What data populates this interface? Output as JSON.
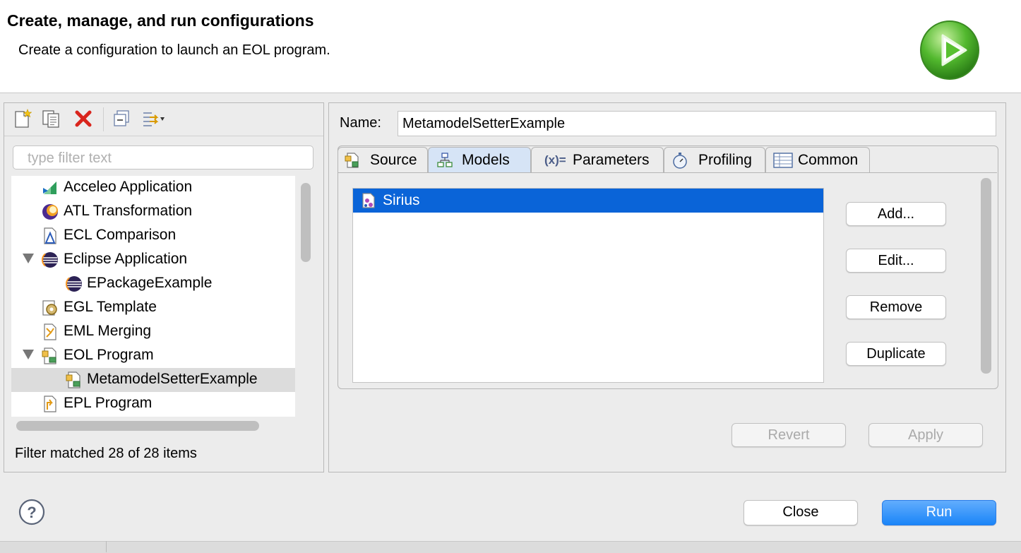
{
  "header": {
    "title": "Create, manage, and run configurations",
    "subtitle": "Create a configuration to launch an EOL program."
  },
  "left": {
    "toolbar": [
      "new-launch-configuration-icon",
      "duplicate-icon",
      "delete-icon",
      "collapse-all-icon",
      "filter-icon"
    ],
    "filter_placeholder": "type filter text",
    "tree": [
      {
        "label": "Acceleo Application",
        "icon": "acceleo-icon",
        "level": 0,
        "expanded": false
      },
      {
        "label": "ATL Transformation",
        "icon": "atl-icon",
        "level": 0,
        "expanded": false
      },
      {
        "label": "ECL Comparison",
        "icon": "ecl-icon",
        "level": 0,
        "expanded": false
      },
      {
        "label": "Eclipse Application",
        "icon": "eclipse-icon",
        "level": 0,
        "expanded": true
      },
      {
        "label": "EPackageExample",
        "icon": "eclipse-icon",
        "level": 1
      },
      {
        "label": "EGL Template",
        "icon": "egl-icon",
        "level": 0,
        "expanded": false
      },
      {
        "label": "EML Merging",
        "icon": "eml-icon",
        "level": 0,
        "expanded": false
      },
      {
        "label": "EOL Program",
        "icon": "eol-icon",
        "level": 0,
        "expanded": true
      },
      {
        "label": "MetamodelSetterExample",
        "icon": "eol-icon",
        "level": 1,
        "selected": true
      },
      {
        "label": "EPL Program",
        "icon": "epl-icon",
        "level": 0,
        "expanded": false
      }
    ],
    "status": "Filter matched 28 of 28 items"
  },
  "right": {
    "name_label": "Name:",
    "name_value": "MetamodelSetterExample",
    "tabs": [
      {
        "label": "Source",
        "icon": "source-icon",
        "active": false
      },
      {
        "label": "Models",
        "icon": "models-icon",
        "active": true
      },
      {
        "label": "Parameters",
        "icon": "parameters-icon",
        "active": false,
        "prefix": "(x)="
      },
      {
        "label": "Profiling",
        "icon": "stopwatch-icon",
        "active": false
      },
      {
        "label": "Common",
        "icon": "table-icon",
        "active": false
      }
    ],
    "models": [
      {
        "label": "Sirius",
        "icon": "model-icon",
        "selected": true
      }
    ],
    "buttons": {
      "add": "Add...",
      "edit": "Edit...",
      "remove": "Remove",
      "duplicate": "Duplicate"
    },
    "revert": "Revert",
    "apply": "Apply"
  },
  "footer": {
    "close": "Close",
    "run": "Run",
    "help_icon": "help-icon"
  },
  "colors": {
    "selection_blue": "#0a64d8",
    "run_button": "#1a85f8",
    "delete_red": "#d9251d",
    "run_logo_green": "#3fae2a"
  }
}
